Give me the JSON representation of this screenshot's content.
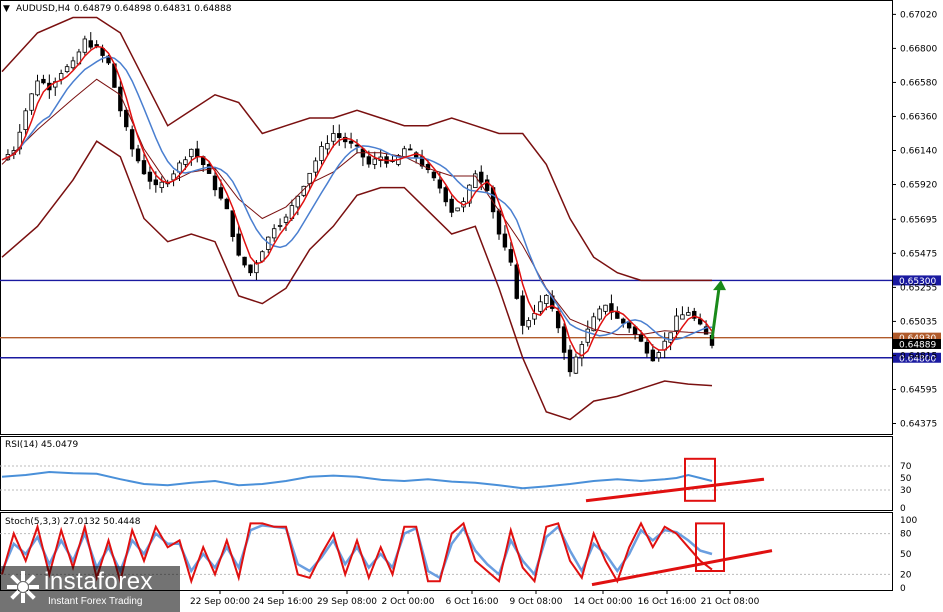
{
  "header": {
    "symbol_label": "AUDUSD,H4",
    "ohlc_label": "0.64879 0.64898 0.64831 0.64888"
  },
  "rsi_panel": {
    "label": "RSI(14) 45.0479"
  },
  "stoch_panel": {
    "label": "Stoch(5,3,3) 27.0132 50.4448"
  },
  "logo": {
    "brand": "instaforex",
    "tagline": "Instant Forex Trading"
  },
  "colors": {
    "candle": "#000000",
    "bollinger": "#7a1010",
    "ma_fast": "#e01010",
    "ma_slow": "#4a7fd0",
    "support_line": "#1a1aa0",
    "resistance_line": "#1a1aa0",
    "mid_line": "#b05a2a",
    "rsi_line": "#4a90d9",
    "stoch_main": "#e01010",
    "stoch_signal": "#6a9ee0",
    "annotation_red": "#e01010",
    "arrow_green": "#1a8a1a"
  },
  "chart_data": [
    {
      "type": "candlestick",
      "name": "AUDUSD,H4",
      "x_ticks": [
        "22 Sep 00:00",
        "24 Sep 16:00",
        "29 Sep 08:00",
        "2 Oct 00:00",
        "6 Oct 16:00",
        "9 Oct 08:00",
        "14 Oct 00:00",
        "16 Oct 16:00",
        "21 Oct 08:00"
      ],
      "y_ticks": [
        0.64375,
        0.64595,
        0.64815,
        0.65035,
        0.65255,
        0.65475,
        0.65695,
        0.6592,
        0.6614,
        0.6636,
        0.6658,
        0.668,
        0.6702
      ],
      "ylim": [
        0.6432,
        0.671
      ],
      "horizontal_levels": [
        {
          "label": "0.65300",
          "value": 0.653,
          "role": "resistance"
        },
        {
          "label": "0.64930",
          "value": 0.6493,
          "role": "mid"
        },
        {
          "label": "0.64889",
          "value": 0.64889,
          "role": "current"
        },
        {
          "label": "0.64800",
          "value": 0.648,
          "role": "support"
        }
      ],
      "close_path": [
        [
          0,
          0.6608
        ],
        [
          2,
          0.6615
        ],
        [
          4,
          0.664
        ],
        [
          6,
          0.666
        ],
        [
          8,
          0.6655
        ],
        [
          10,
          0.6665
        ],
        [
          12,
          0.667
        ],
        [
          14,
          0.6685
        ],
        [
          16,
          0.668
        ],
        [
          18,
          0.667
        ],
        [
          20,
          0.664
        ],
        [
          22,
          0.6615
        ],
        [
          24,
          0.66
        ],
        [
          26,
          0.659
        ],
        [
          28,
          0.6595
        ],
        [
          30,
          0.6605
        ],
        [
          32,
          0.6615
        ],
        [
          34,
          0.6605
        ],
        [
          36,
          0.659
        ],
        [
          38,
          0.6575
        ],
        [
          40,
          0.6545
        ],
        [
          42,
          0.6535
        ],
        [
          44,
          0.655
        ],
        [
          46,
          0.6565
        ],
        [
          48,
          0.657
        ],
        [
          50,
          0.6585
        ],
        [
          52,
          0.66
        ],
        [
          54,
          0.6615
        ],
        [
          56,
          0.6625
        ],
        [
          58,
          0.662
        ],
        [
          60,
          0.6615
        ],
        [
          62,
          0.6605
        ],
        [
          64,
          0.661
        ],
        [
          66,
          0.6605
        ],
        [
          68,
          0.6615
        ],
        [
          70,
          0.661
        ],
        [
          72,
          0.66
        ],
        [
          74,
          0.659
        ],
        [
          76,
          0.6575
        ],
        [
          78,
          0.658
        ],
        [
          80,
          0.66
        ],
        [
          82,
          0.659
        ],
        [
          84,
          0.656
        ],
        [
          86,
          0.654
        ],
        [
          88,
          0.65
        ],
        [
          90,
          0.651
        ],
        [
          92,
          0.652
        ],
        [
          94,
          0.65
        ],
        [
          96,
          0.647
        ],
        [
          98,
          0.649
        ],
        [
          100,
          0.6505
        ],
        [
          102,
          0.6515
        ],
        [
          104,
          0.6505
        ],
        [
          106,
          0.65
        ],
        [
          108,
          0.649
        ],
        [
          110,
          0.648
        ],
        [
          112,
          0.649
        ],
        [
          114,
          0.6505
        ],
        [
          116,
          0.651
        ],
        [
          118,
          0.65
        ],
        [
          120,
          0.6489
        ]
      ],
      "bollinger_upper": [
        [
          0,
          0.6665
        ],
        [
          6,
          0.669
        ],
        [
          12,
          0.67
        ],
        [
          16,
          0.67
        ],
        [
          20,
          0.669
        ],
        [
          24,
          0.666
        ],
        [
          28,
          0.663
        ],
        [
          32,
          0.664
        ],
        [
          36,
          0.665
        ],
        [
          40,
          0.6645
        ],
        [
          44,
          0.6625
        ],
        [
          48,
          0.663
        ],
        [
          52,
          0.6635
        ],
        [
          56,
          0.6635
        ],
        [
          60,
          0.664
        ],
        [
          64,
          0.6635
        ],
        [
          68,
          0.663
        ],
        [
          72,
          0.663
        ],
        [
          76,
          0.6635
        ],
        [
          80,
          0.663
        ],
        [
          84,
          0.6625
        ],
        [
          88,
          0.6625
        ],
        [
          92,
          0.6605
        ],
        [
          96,
          0.657
        ],
        [
          100,
          0.6545
        ],
        [
          104,
          0.6535
        ],
        [
          108,
          0.653
        ],
        [
          112,
          0.653
        ],
        [
          116,
          0.653
        ],
        [
          120,
          0.653
        ]
      ],
      "bollinger_lower": [
        [
          0,
          0.6545
        ],
        [
          6,
          0.6565
        ],
        [
          12,
          0.6595
        ],
        [
          16,
          0.662
        ],
        [
          20,
          0.661
        ],
        [
          24,
          0.657
        ],
        [
          28,
          0.6555
        ],
        [
          32,
          0.656
        ],
        [
          36,
          0.6555
        ],
        [
          40,
          0.652
        ],
        [
          44,
          0.6515
        ],
        [
          48,
          0.6525
        ],
        [
          52,
          0.655
        ],
        [
          56,
          0.6565
        ],
        [
          60,
          0.6585
        ],
        [
          64,
          0.659
        ],
        [
          68,
          0.659
        ],
        [
          72,
          0.6575
        ],
        [
          76,
          0.656
        ],
        [
          80,
          0.6565
        ],
        [
          84,
          0.6525
        ],
        [
          88,
          0.648
        ],
        [
          92,
          0.6445
        ],
        [
          96,
          0.644
        ],
        [
          100,
          0.6452
        ],
        [
          104,
          0.6455
        ],
        [
          108,
          0.646
        ],
        [
          112,
          0.6465
        ],
        [
          116,
          0.6463
        ],
        [
          120,
          0.6462
        ]
      ]
    },
    {
      "type": "line",
      "name": "RSI(14) 45.0479",
      "y_ticks": [
        70,
        50,
        30,
        0
      ],
      "ylim": [
        0,
        100
      ],
      "values": [
        [
          0,
          52
        ],
        [
          4,
          55
        ],
        [
          8,
          60
        ],
        [
          12,
          58
        ],
        [
          16,
          57
        ],
        [
          20,
          48
        ],
        [
          24,
          40
        ],
        [
          28,
          38
        ],
        [
          32,
          42
        ],
        [
          36,
          45
        ],
        [
          40,
          38
        ],
        [
          44,
          40
        ],
        [
          48,
          45
        ],
        [
          52,
          52
        ],
        [
          56,
          54
        ],
        [
          60,
          52
        ],
        [
          64,
          47
        ],
        [
          68,
          45
        ],
        [
          72,
          48
        ],
        [
          76,
          44
        ],
        [
          80,
          42
        ],
        [
          84,
          38
        ],
        [
          88,
          33
        ],
        [
          92,
          36
        ],
        [
          96,
          40
        ],
        [
          100,
          45
        ],
        [
          104,
          48
        ],
        [
          108,
          45
        ],
        [
          112,
          48
        ],
        [
          114,
          50
        ],
        [
          116,
          55
        ],
        [
          118,
          50
        ],
        [
          120,
          45
        ]
      ]
    },
    {
      "type": "line",
      "name": "Stoch(5,3,3) 27.0132 50.4448",
      "y_ticks": [
        100,
        80,
        50,
        20,
        0
      ],
      "ylim": [
        0,
        100
      ],
      "main": [
        [
          0,
          20
        ],
        [
          2,
          80
        ],
        [
          4,
          40
        ],
        [
          6,
          90
        ],
        [
          8,
          20
        ],
        [
          10,
          85
        ],
        [
          12,
          30
        ],
        [
          14,
          90
        ],
        [
          16,
          15
        ],
        [
          18,
          70
        ],
        [
          20,
          10
        ],
        [
          22,
          85
        ],
        [
          24,
          40
        ],
        [
          26,
          90
        ],
        [
          28,
          60
        ],
        [
          30,
          70
        ],
        [
          32,
          10
        ],
        [
          34,
          60
        ],
        [
          36,
          20
        ],
        [
          38,
          70
        ],
        [
          40,
          15
        ],
        [
          42,
          95
        ],
        [
          44,
          95
        ],
        [
          46,
          90
        ],
        [
          48,
          90
        ],
        [
          50,
          20
        ],
        [
          52,
          15
        ],
        [
          54,
          50
        ],
        [
          56,
          80
        ],
        [
          58,
          20
        ],
        [
          60,
          70
        ],
        [
          62,
          15
        ],
        [
          64,
          60
        ],
        [
          66,
          20
        ],
        [
          68,
          90
        ],
        [
          70,
          90
        ],
        [
          72,
          10
        ],
        [
          74,
          10
        ],
        [
          76,
          80
        ],
        [
          78,
          95
        ],
        [
          80,
          40
        ],
        [
          82,
          25
        ],
        [
          84,
          10
        ],
        [
          86,
          85
        ],
        [
          88,
          30
        ],
        [
          90,
          10
        ],
        [
          92,
          90
        ],
        [
          94,
          95
        ],
        [
          96,
          40
        ],
        [
          98,
          15
        ],
        [
          100,
          80
        ],
        [
          102,
          40
        ],
        [
          104,
          10
        ],
        [
          106,
          60
        ],
        [
          108,
          95
        ],
        [
          110,
          60
        ],
        [
          112,
          90
        ],
        [
          114,
          80
        ],
        [
          116,
          60
        ],
        [
          118,
          40
        ],
        [
          120,
          27
        ]
      ],
      "signal": [
        [
          0,
          25
        ],
        [
          2,
          65
        ],
        [
          4,
          50
        ],
        [
          6,
          75
        ],
        [
          8,
          35
        ],
        [
          10,
          70
        ],
        [
          12,
          40
        ],
        [
          14,
          80
        ],
        [
          16,
          30
        ],
        [
          18,
          60
        ],
        [
          20,
          25
        ],
        [
          22,
          70
        ],
        [
          24,
          50
        ],
        [
          26,
          80
        ],
        [
          28,
          65
        ],
        [
          30,
          65
        ],
        [
          32,
          25
        ],
        [
          34,
          50
        ],
        [
          36,
          30
        ],
        [
          38,
          60
        ],
        [
          40,
          30
        ],
        [
          42,
          85
        ],
        [
          44,
          92
        ],
        [
          46,
          90
        ],
        [
          48,
          88
        ],
        [
          50,
          35
        ],
        [
          52,
          25
        ],
        [
          54,
          45
        ],
        [
          56,
          70
        ],
        [
          58,
          35
        ],
        [
          60,
          60
        ],
        [
          62,
          30
        ],
        [
          64,
          50
        ],
        [
          66,
          30
        ],
        [
          68,
          80
        ],
        [
          70,
          88
        ],
        [
          72,
          25
        ],
        [
          74,
          15
        ],
        [
          76,
          65
        ],
        [
          78,
          88
        ],
        [
          80,
          55
        ],
        [
          82,
          35
        ],
        [
          84,
          20
        ],
        [
          86,
          70
        ],
        [
          88,
          40
        ],
        [
          90,
          20
        ],
        [
          92,
          75
        ],
        [
          94,
          90
        ],
        [
          96,
          55
        ],
        [
          98,
          25
        ],
        [
          100,
          65
        ],
        [
          102,
          50
        ],
        [
          104,
          25
        ],
        [
          106,
          50
        ],
        [
          108,
          85
        ],
        [
          110,
          70
        ],
        [
          112,
          85
        ],
        [
          114,
          82
        ],
        [
          116,
          70
        ],
        [
          118,
          55
        ],
        [
          120,
          50
        ]
      ]
    }
  ]
}
